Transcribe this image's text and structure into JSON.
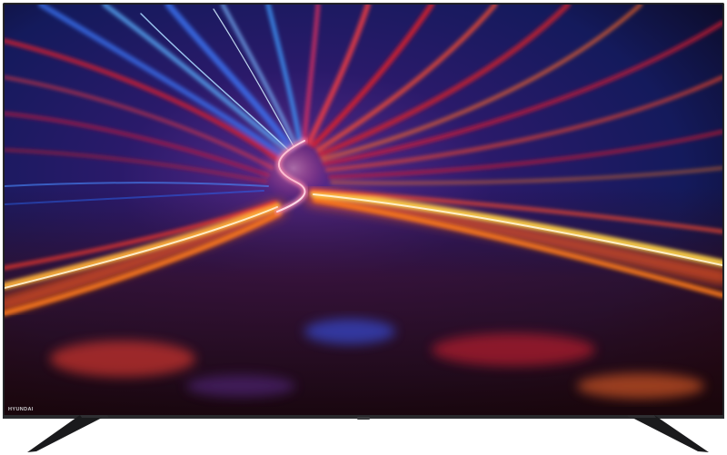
{
  "product": {
    "brand_logo_text": "HYUNDAI"
  },
  "screen": {
    "content": "abstract-light-tunnel-wallpaper",
    "colors": {
      "deep_blue": "#141a5c",
      "bright_blue": "#3d7bff",
      "violet": "#5a2a8a",
      "red": "#e0202a",
      "orange": "#ff7a1a",
      "yellow": "#ffd34a",
      "white_hot": "#fff4d6"
    }
  },
  "frame": {
    "bezel_color": "#1e1e20",
    "stand_color": "#1a1a1c"
  }
}
